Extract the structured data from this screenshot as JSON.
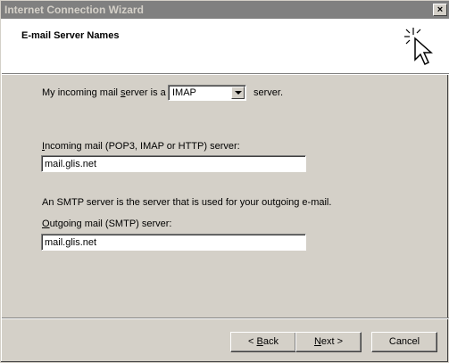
{
  "window": {
    "title": "Internet Connection Wizard",
    "close_glyph": "×"
  },
  "header": {
    "heading": "E-mail Server Names",
    "icon": "wizard-cursor-sparkle-icon"
  },
  "incoming_type": {
    "prefix_a": "My incoming mail ",
    "prefix_mn": "s",
    "prefix_b": "erver is a",
    "selected": "IMAP",
    "suffix": "server."
  },
  "incoming_server": {
    "label_mn": "I",
    "label_rest": "ncoming mail (POP3, IMAP or HTTP) server:",
    "value": "mail.glis.net"
  },
  "smtp_note": "An SMTP server is the server that is used for your outgoing e-mail.",
  "outgoing_server": {
    "label_mn": "O",
    "label_rest": "utgoing mail (SMTP) server:",
    "value": "mail.glis.net"
  },
  "buttons": {
    "back_prefix": "< ",
    "back_mn": "B",
    "back_rest": "ack",
    "next_mn": "N",
    "next_rest": "ext >",
    "cancel": "Cancel"
  }
}
